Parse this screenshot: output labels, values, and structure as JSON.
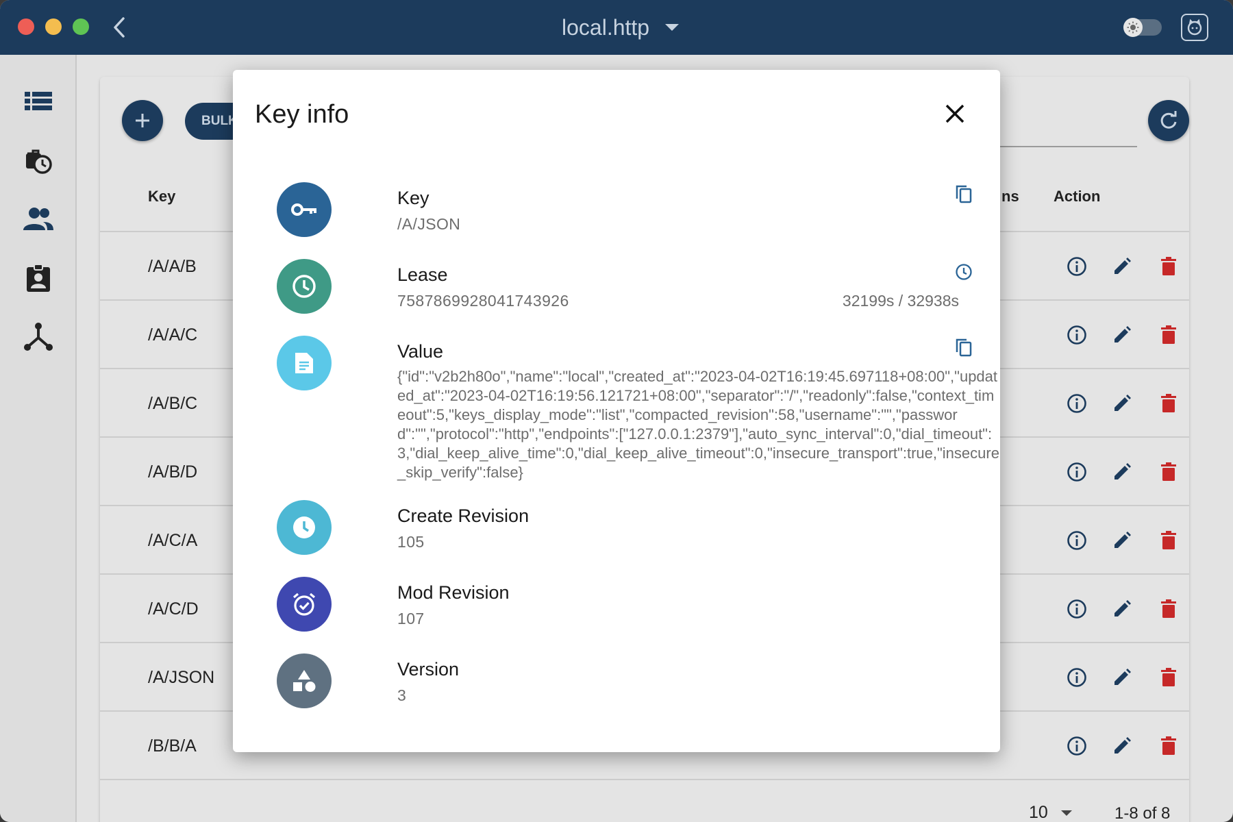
{
  "window": {
    "title": "local.http"
  },
  "table": {
    "headers": {
      "key": "Key",
      "versions": "ns",
      "action": "Action"
    },
    "rows": [
      {
        "key": "/A/A/B"
      },
      {
        "key": "/A/A/C"
      },
      {
        "key": "/A/B/C"
      },
      {
        "key": "/A/B/D"
      },
      {
        "key": "/A/C/A"
      },
      {
        "key": "/A/C/D"
      },
      {
        "key": "/A/JSON"
      },
      {
        "key": "/B/B/A"
      }
    ],
    "bulk_label": "BULK",
    "pager": {
      "page_size": "10",
      "range": "1-8 of 8"
    }
  },
  "dialog": {
    "title": "Key info",
    "key": {
      "label": "Key",
      "value": "/A/JSON"
    },
    "lease": {
      "label": "Lease",
      "value": "7587869928041743926",
      "ttl": "32199s / 32938s"
    },
    "value": {
      "label": "Value",
      "value": "{\"id\":\"v2b2h80o\",\"name\":\"local\",\"created_at\":\"2023-04-02T16:19:45.697118+08:00\",\"updated_at\":\"2023-04-02T16:19:56.121721+08:00\",\"separator\":\"/\",\"readonly\":false,\"context_timeout\":5,\"keys_display_mode\":\"list\",\"compacted_revision\":58,\"username\":\"\",\"password\":\"\",\"protocol\":\"http\",\"endpoints\":[\"127.0.0.1:2379\"],\"auto_sync_interval\":0,\"dial_timeout\":3,\"dial_keep_alive_time\":0,\"dial_keep_alive_timeout\":0,\"insecure_transport\":true,\"insecure_skip_verify\":false}"
    },
    "create_revision": {
      "label": "Create Revision",
      "value": "105"
    },
    "mod_revision": {
      "label": "Mod Revision",
      "value": "107"
    },
    "version": {
      "label": "Version",
      "value": "3"
    }
  },
  "colors": {
    "titlebar": "#1c3b5c",
    "key_avatar": "#2a6496",
    "lease_avatar": "#3f9a86",
    "value_avatar": "#5bc8e8",
    "create_avatar": "#4db8d4",
    "mod_avatar": "#3f48b0",
    "version_avatar": "#5f7181",
    "delete": "#c62828",
    "edit": "#1c3b5c"
  }
}
